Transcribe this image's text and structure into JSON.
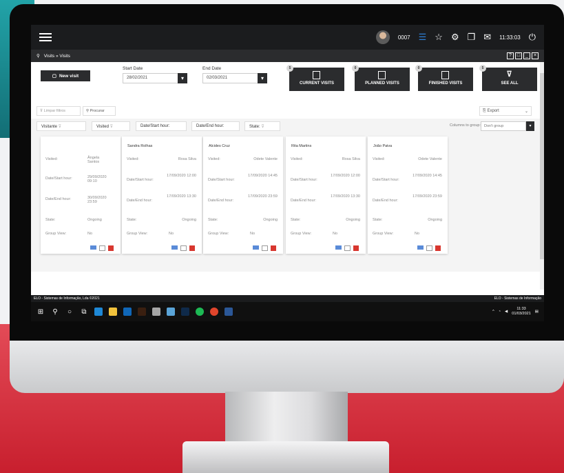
{
  "header": {
    "user": "0007",
    "clock": "11:33:03",
    "breadcrumb": "Visits » Visits"
  },
  "filters": {
    "new_visit_label": "New visit",
    "start_date_label": "Start Date",
    "start_date_value": "28/02/2021",
    "end_date_label": "End Date",
    "end_date_value": "02/03/2021",
    "clear_filters_label": "Limpar filtros",
    "search_label": "Procurar",
    "export_label": "Export"
  },
  "visit_buttons": [
    {
      "label": "CURRENT VISITS",
      "badge": "5"
    },
    {
      "label": "PLANNED VISITS",
      "badge": "0"
    },
    {
      "label": "FINISHED VISITS",
      "badge": "0"
    },
    {
      "label": "SEE ALL",
      "badge": "5"
    }
  ],
  "columns": {
    "headers": [
      "Visitante",
      "Visited",
      "Date/Start hour:",
      "Date/End hour:",
      "State:"
    ],
    "group_label": "Columns to group:",
    "group_value": "Don't group"
  },
  "field_labels": {
    "visited": "Visited:",
    "start": "Date/Start hour:",
    "end": "Date/End hour:",
    "state": "State:",
    "group_view": "Group View:"
  },
  "cards": [
    {
      "visitor": "",
      "visited": "Ângela Santos",
      "start": "29/09/2020 09:10",
      "end": "30/09/2020 23:59",
      "state": "Ongoing",
      "group_view": "No"
    },
    {
      "visitor": "Sandra Rolhas",
      "visited": "Rosa Silva",
      "start": "17/09/2020 12:00",
      "end": "17/09/2020 13:30",
      "state": "Ongoing",
      "group_view": "No"
    },
    {
      "visitor": "Alcides Cruz",
      "visited": "Odete Valente",
      "start": "17/09/2020 14:45",
      "end": "17/09/2020 23:59",
      "state": "Ongoing",
      "group_view": "No"
    },
    {
      "visitor": "Rita Martins",
      "visited": "Rosa Silva",
      "start": "17/09/2020 12:00",
      "end": "17/09/2020 13:30",
      "state": "Ongoing",
      "group_view": "No"
    },
    {
      "visitor": "João Paiva",
      "visited": "Odete Valente",
      "start": "17/09/2020 14:45",
      "end": "17/09/2020 23:59",
      "state": "Ongoing",
      "group_view": "No"
    }
  ],
  "status": {
    "left": "ELO - Sistemas de Informação, Lda ©2021",
    "right": "ELO - Sistemas de Informação"
  },
  "taskbar": {
    "time": "11:33",
    "date": "01/03/2021"
  }
}
